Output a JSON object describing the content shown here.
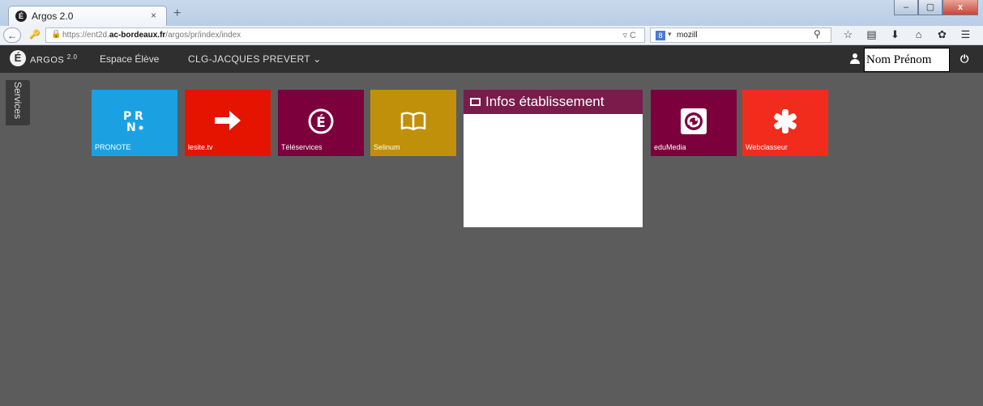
{
  "browser": {
    "tab_title": "Argos 2.0",
    "tab_close": "×",
    "new_tab": "+",
    "window_controls": [
      "–",
      "▢",
      "x"
    ],
    "back": "←",
    "url_prefix": "https://ent2d.",
    "url_domain": "ac-bordeaux.fr",
    "url_path": "/argos/pr/index/index",
    "url_controls": "▿ C",
    "search_engine": "8",
    "search_text": "mozill",
    "search_icon": "⚲",
    "toolbar_icons": [
      "star-icon",
      "bookmarks-icon",
      "download-icon",
      "home-icon",
      "addon-icon",
      "menu-icon"
    ]
  },
  "app": {
    "logo_letter": "É",
    "logo_text": "ARGOS",
    "logo_version": "2.0",
    "nav_espace": "Espace Élève",
    "nav_etablissement": "CLG-JACQUES PREVERT ⌄",
    "user_name": "Nom Prénom",
    "power_icon": "⏻",
    "services_label": "Services"
  },
  "tiles": [
    {
      "label": "PRONOTE",
      "color": "#1ba1e2",
      "icon": "PR N"
    },
    {
      "label": "lesite.tv",
      "color": "#e51400",
      "icon": "➔"
    },
    {
      "label": "Téléservices",
      "color": "#7b003c",
      "icon": "É"
    },
    {
      "label": "Selinum",
      "color": "#c1900a",
      "icon": "book"
    },
    {
      "label": "eduMedia",
      "color": "#7b003c",
      "icon": "swirl"
    },
    {
      "label": "Webclasseur",
      "color": "#f22c1c",
      "icon": "✱"
    }
  ],
  "infos": {
    "title": "Infos établissement",
    "header_color": "#7a1b4b"
  }
}
